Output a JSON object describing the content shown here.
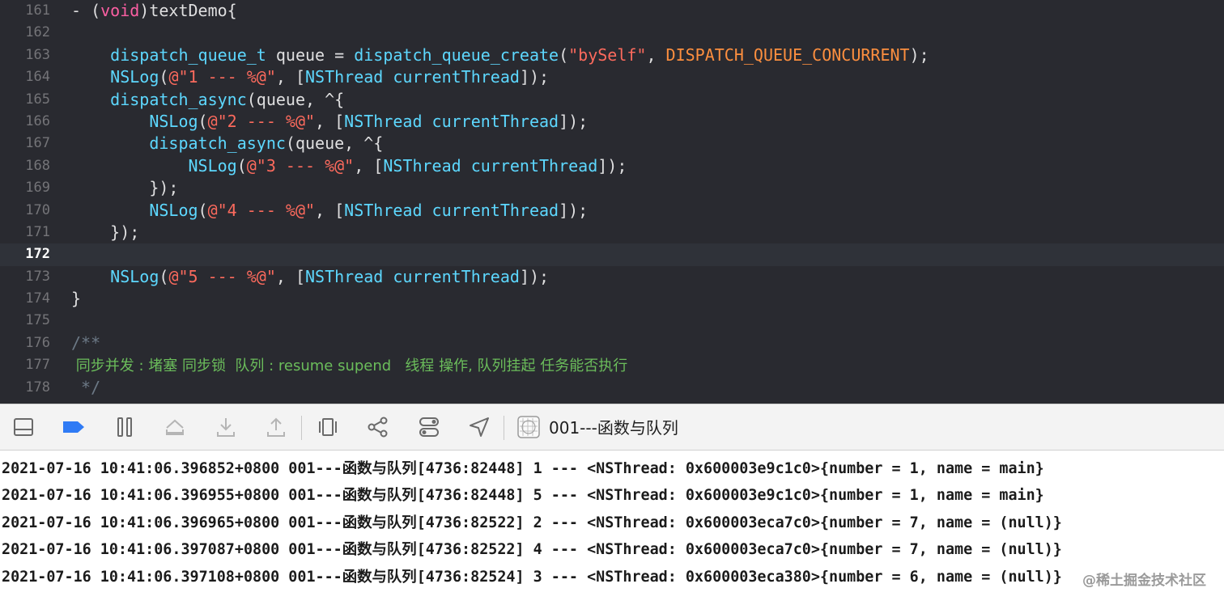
{
  "editor": {
    "current_line": 172,
    "lines": [
      {
        "n": "161",
        "tokens": [
          {
            "t": "- (",
            "c": "plain"
          },
          {
            "t": "void",
            "c": "kw"
          },
          {
            "t": ")textDemo{",
            "c": "plain"
          }
        ]
      },
      {
        "n": "162",
        "tokens": []
      },
      {
        "n": "163",
        "tokens": [
          {
            "t": "    ",
            "c": "plain"
          },
          {
            "t": "dispatch_queue_t",
            "c": "type"
          },
          {
            "t": " queue = ",
            "c": "plain"
          },
          {
            "t": "dispatch_queue_create",
            "c": "type"
          },
          {
            "t": "(",
            "c": "plain"
          },
          {
            "t": "\"bySelf\"",
            "c": "str"
          },
          {
            "t": ", ",
            "c": "plain"
          },
          {
            "t": "DISPATCH_QUEUE_CONCURRENT",
            "c": "const"
          },
          {
            "t": ");",
            "c": "plain"
          }
        ]
      },
      {
        "n": "164",
        "tokens": [
          {
            "t": "    ",
            "c": "plain"
          },
          {
            "t": "NSLog",
            "c": "type"
          },
          {
            "t": "(",
            "c": "plain"
          },
          {
            "t": "@\"1 --- %@\"",
            "c": "str"
          },
          {
            "t": ", [",
            "c": "plain"
          },
          {
            "t": "NSThread",
            "c": "cls"
          },
          {
            "t": " ",
            "c": "plain"
          },
          {
            "t": "currentThread",
            "c": "cls"
          },
          {
            "t": "]);",
            "c": "plain"
          }
        ]
      },
      {
        "n": "165",
        "tokens": [
          {
            "t": "    ",
            "c": "plain"
          },
          {
            "t": "dispatch_async",
            "c": "type"
          },
          {
            "t": "(queue, ^{",
            "c": "plain"
          }
        ]
      },
      {
        "n": "166",
        "tokens": [
          {
            "t": "        ",
            "c": "plain"
          },
          {
            "t": "NSLog",
            "c": "type"
          },
          {
            "t": "(",
            "c": "plain"
          },
          {
            "t": "@\"2 --- %@\"",
            "c": "str"
          },
          {
            "t": ", [",
            "c": "plain"
          },
          {
            "t": "NSThread",
            "c": "cls"
          },
          {
            "t": " ",
            "c": "plain"
          },
          {
            "t": "currentThread",
            "c": "cls"
          },
          {
            "t": "]);",
            "c": "plain"
          }
        ]
      },
      {
        "n": "167",
        "tokens": [
          {
            "t": "        ",
            "c": "plain"
          },
          {
            "t": "dispatch_async",
            "c": "type"
          },
          {
            "t": "(queue, ^{",
            "c": "plain"
          }
        ]
      },
      {
        "n": "168",
        "tokens": [
          {
            "t": "            ",
            "c": "plain"
          },
          {
            "t": "NSLog",
            "c": "type"
          },
          {
            "t": "(",
            "c": "plain"
          },
          {
            "t": "@\"3 --- %@\"",
            "c": "str"
          },
          {
            "t": ", [",
            "c": "plain"
          },
          {
            "t": "NSThread",
            "c": "cls"
          },
          {
            "t": " ",
            "c": "plain"
          },
          {
            "t": "currentThread",
            "c": "cls"
          },
          {
            "t": "]);",
            "c": "plain"
          }
        ]
      },
      {
        "n": "169",
        "tokens": [
          {
            "t": "        });",
            "c": "plain"
          }
        ]
      },
      {
        "n": "170",
        "tokens": [
          {
            "t": "        ",
            "c": "plain"
          },
          {
            "t": "NSLog",
            "c": "type"
          },
          {
            "t": "(",
            "c": "plain"
          },
          {
            "t": "@\"4 --- %@\"",
            "c": "str"
          },
          {
            "t": ", [",
            "c": "plain"
          },
          {
            "t": "NSThread",
            "c": "cls"
          },
          {
            "t": " ",
            "c": "plain"
          },
          {
            "t": "currentThread",
            "c": "cls"
          },
          {
            "t": "]);",
            "c": "plain"
          }
        ]
      },
      {
        "n": "171",
        "tokens": [
          {
            "t": "    });",
            "c": "plain"
          }
        ]
      },
      {
        "n": "172",
        "tokens": []
      },
      {
        "n": "173",
        "tokens": [
          {
            "t": "    ",
            "c": "plain"
          },
          {
            "t": "NSLog",
            "c": "type"
          },
          {
            "t": "(",
            "c": "plain"
          },
          {
            "t": "@\"5 --- %@\"",
            "c": "str"
          },
          {
            "t": ", [",
            "c": "plain"
          },
          {
            "t": "NSThread",
            "c": "cls"
          },
          {
            "t": " ",
            "c": "plain"
          },
          {
            "t": "currentThread",
            "c": "cls"
          },
          {
            "t": "]);",
            "c": "plain"
          }
        ]
      },
      {
        "n": "174",
        "tokens": [
          {
            "t": "}",
            "c": "plain"
          }
        ]
      },
      {
        "n": "175",
        "tokens": []
      },
      {
        "n": "176",
        "tokens": [
          {
            "t": "/**",
            "c": "comment"
          }
        ]
      },
      {
        "n": "177",
        "tokens": [
          {
            "t": " 同步并发 : 堵塞 同步锁  队列 : resume supend   线程 操作, 队列挂起 任务能否执行",
            "c": "doc",
            "cn": true
          }
        ]
      },
      {
        "n": "178",
        "tokens": [
          {
            "t": " */",
            "c": "comment"
          }
        ]
      }
    ]
  },
  "toolbar": {
    "buttons": [
      {
        "name": "hide-debug-area-button",
        "icon": "panel-bottom-icon"
      },
      {
        "name": "breakpoints-toggle-button",
        "icon": "breakpoint-icon",
        "active": true
      },
      {
        "name": "pause-button",
        "icon": "pause-icon"
      },
      {
        "name": "step-over-button",
        "icon": "step-over-icon"
      },
      {
        "name": "step-into-button",
        "icon": "step-into-icon"
      },
      {
        "name": "step-out-button",
        "icon": "step-out-icon"
      },
      {
        "name": "view-hierarchy-button",
        "icon": "view-hierarchy-icon"
      },
      {
        "name": "memory-graph-button",
        "icon": "memory-graph-icon"
      },
      {
        "name": "environment-overrides-button",
        "icon": "toggles-icon"
      },
      {
        "name": "simulate-location-button",
        "icon": "location-arrow-icon"
      }
    ],
    "target_icon": "target-app-icon",
    "target_title": "001---函数与队列",
    "accent_color": "#2f7bf5"
  },
  "console": {
    "lines": [
      "2021-07-16 10:41:06.396852+0800 001---函数与队列[4736:82448] 1 --- <NSThread: 0x600003e9c1c0>{number = 1, name = main}",
      "2021-07-16 10:41:06.396955+0800 001---函数与队列[4736:82448] 5 --- <NSThread: 0x600003e9c1c0>{number = 1, name = main}",
      "2021-07-16 10:41:06.396965+0800 001---函数与队列[4736:82522] 2 --- <NSThread: 0x600003eca7c0>{number = 7, name = (null)}",
      "2021-07-16 10:41:06.397087+0800 001---函数与队列[4736:82522] 4 --- <NSThread: 0x600003eca7c0>{number = 7, name = (null)}",
      "2021-07-16 10:41:06.397108+0800 001---函数与队列[4736:82524] 3 --- <NSThread: 0x600003eca380>{number = 6, name = (null)}"
    ],
    "watermark": "@稀土掘金技术社区"
  }
}
